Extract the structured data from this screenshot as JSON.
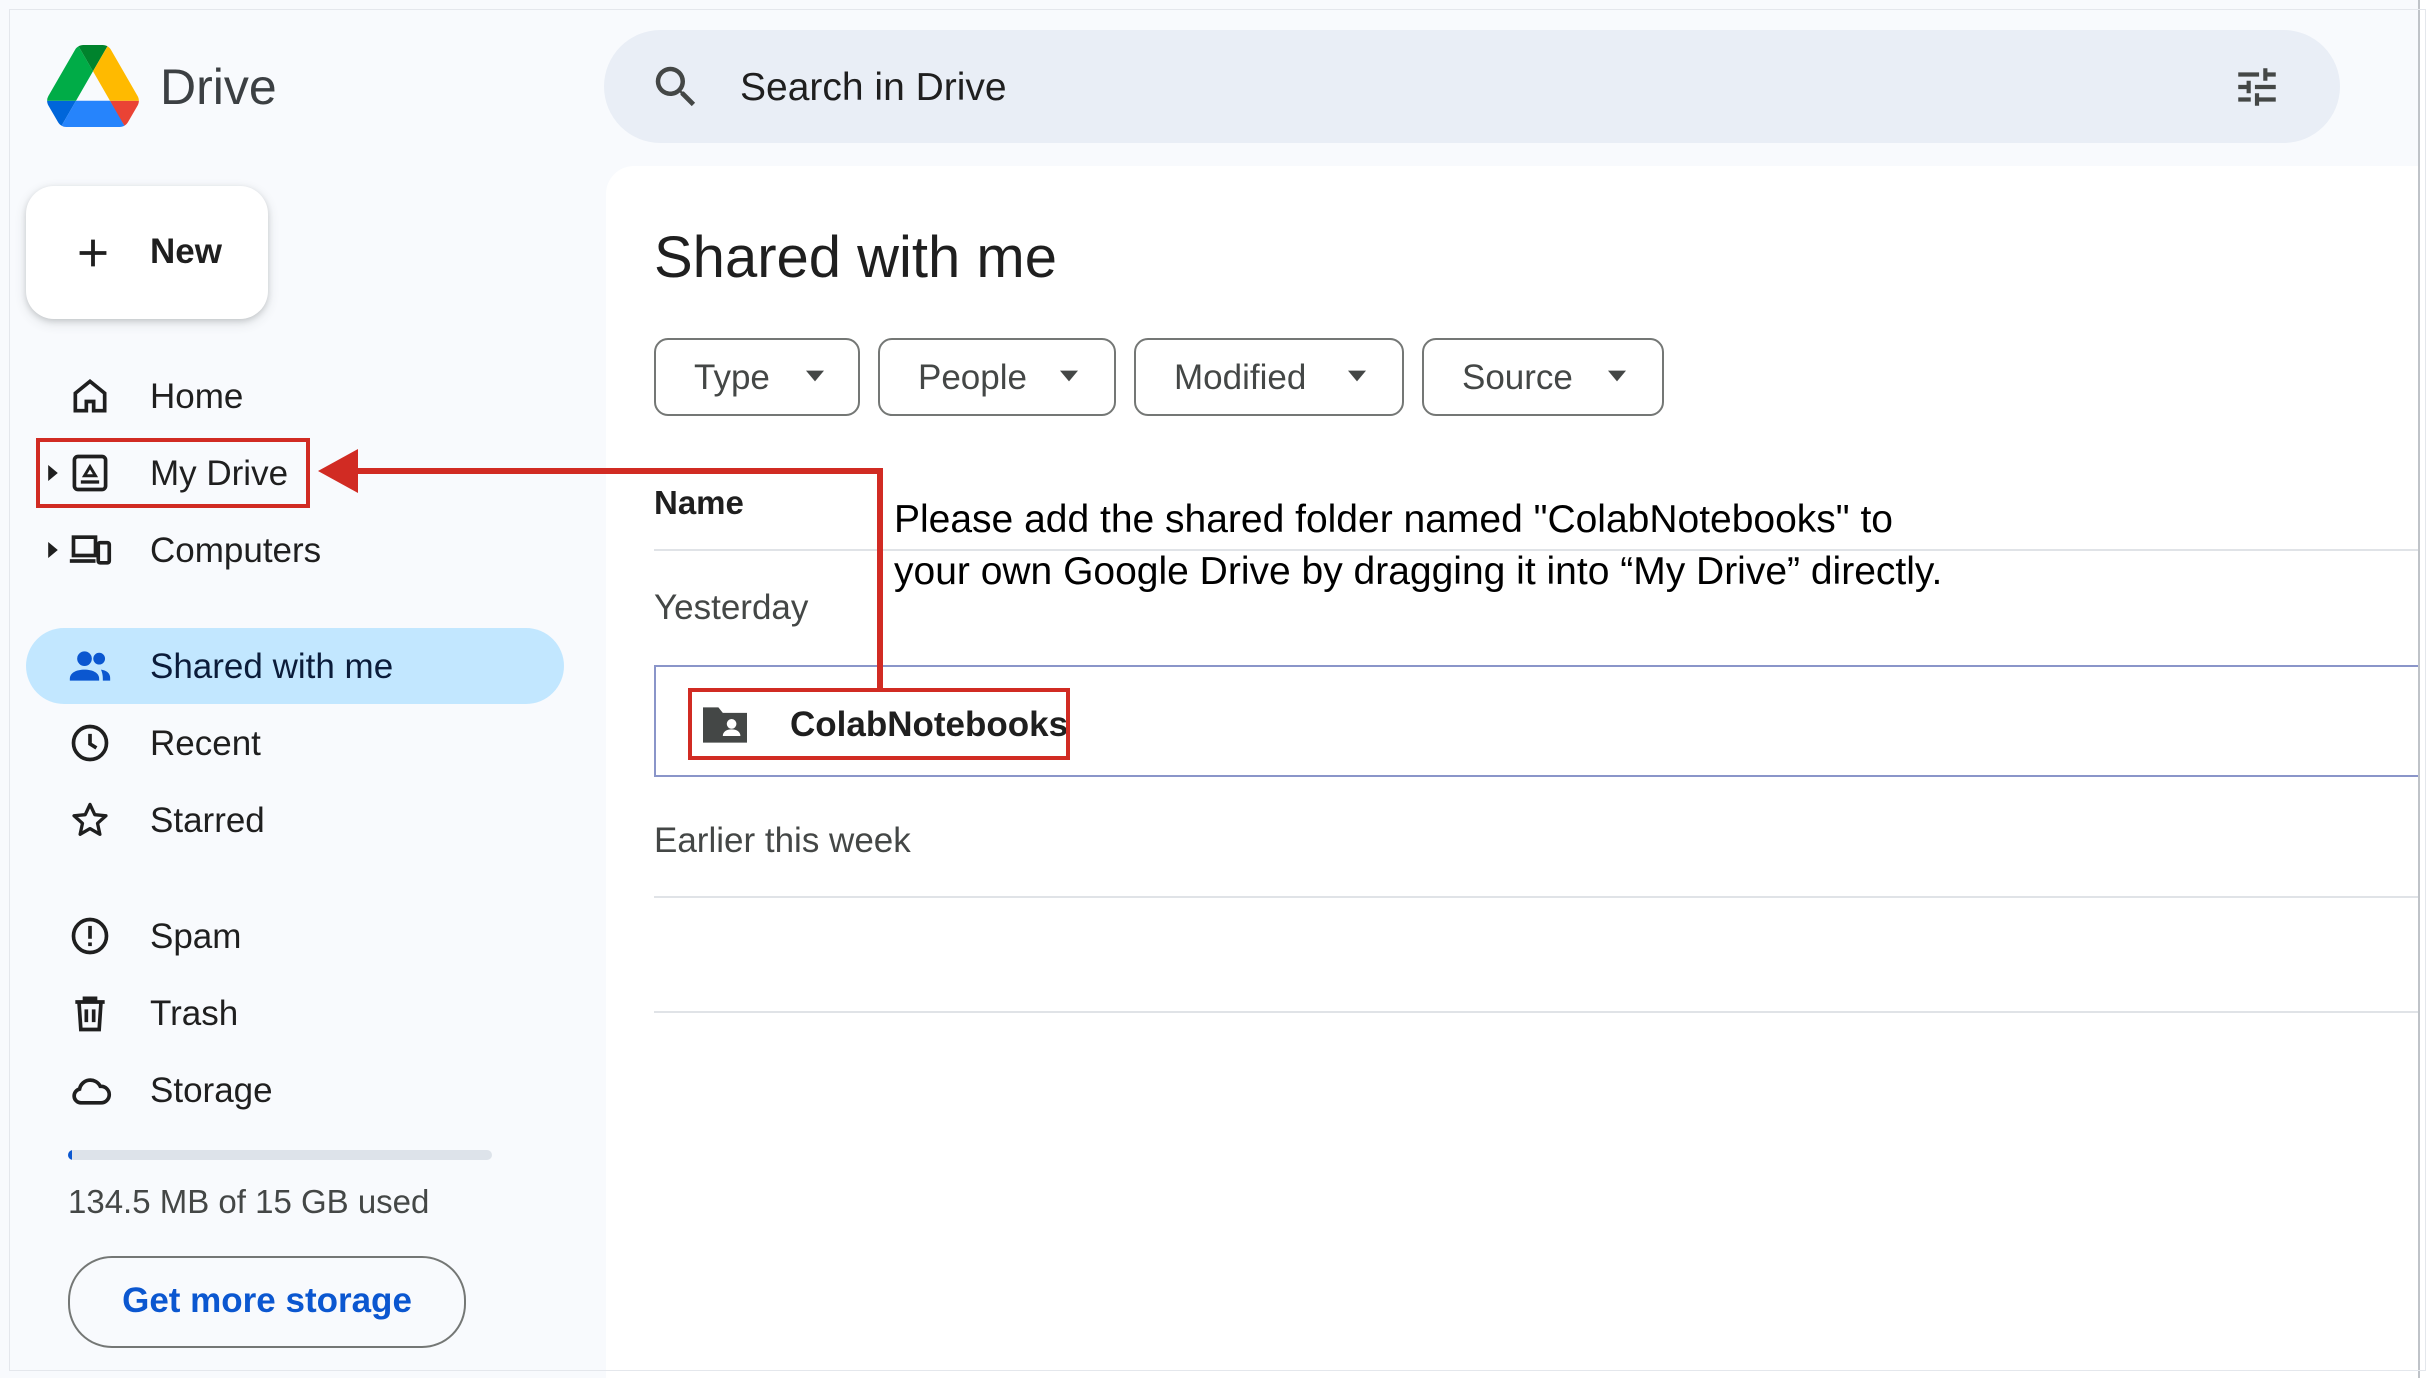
{
  "app": {
    "brand": "Drive",
    "logo_colors": [
      "#0066da",
      "#00ac47",
      "#ea4335",
      "#00832d",
      "#2684fc",
      "#ffba00"
    ]
  },
  "header": {
    "search_placeholder": "Search in Drive",
    "icons": [
      "search-icon",
      "tune-icon"
    ]
  },
  "sidebar": {
    "new_label": "New",
    "items": [
      {
        "label": "Home",
        "icon": "home-icon"
      },
      {
        "label": "My Drive",
        "icon": "my-drive-icon",
        "expandable": true
      },
      {
        "label": "Computers",
        "icon": "computers-icon",
        "expandable": true
      },
      {
        "label": "Shared with me",
        "icon": "shared-icon",
        "active": true
      },
      {
        "label": "Recent",
        "icon": "clock-icon"
      },
      {
        "label": "Starred",
        "icon": "star-icon"
      },
      {
        "label": "Spam",
        "icon": "spam-icon"
      },
      {
        "label": "Trash",
        "icon": "trash-icon"
      },
      {
        "label": "Storage",
        "icon": "cloud-icon"
      }
    ],
    "storage": {
      "used_text": "134.5 MB of 15 GB used",
      "used_fraction": 0.009,
      "button_label": "Get more storage"
    }
  },
  "main": {
    "title": "Shared with me",
    "filters": [
      "Type",
      "People",
      "Modified",
      "Source"
    ],
    "column_header": "Name",
    "groups": [
      {
        "label": "Yesterday",
        "rows": [
          {
            "name": "ColabNotebooks",
            "icon": "shared-folder-icon",
            "selected": true
          }
        ]
      },
      {
        "label": "Earlier this week",
        "rows": []
      }
    ]
  },
  "annotation": {
    "instruction_line1": "Please add the shared folder named \"ColabNotebooks\" to",
    "instruction_line2": "your own Google Drive by dragging it into “My Drive” directly.",
    "highlight_color": "#d12b23"
  },
  "colors": {
    "active_nav": "#c2e7ff",
    "accent_blue": "#0b57d0",
    "search_bg": "#e9eef6"
  }
}
